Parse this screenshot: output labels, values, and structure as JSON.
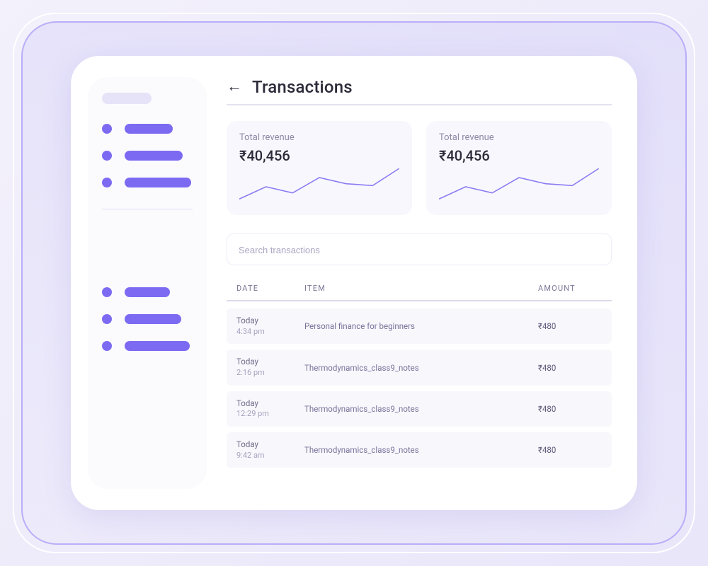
{
  "header": {
    "title": "Transactions",
    "back_icon": "arrow-left"
  },
  "cards": [
    {
      "label": "Total revenue",
      "value": "₹40,456"
    },
    {
      "label": "Total revenue",
      "value": "₹40,456"
    }
  ],
  "search": {
    "placeholder": "Search transactions"
  },
  "table": {
    "headers": {
      "date": "DATE",
      "item": "ITEM",
      "amount": "AMOUNT"
    },
    "rows": [
      {
        "date_line1": "Today",
        "date_line2": "4:34 pm",
        "item": "Personal finance for beginners",
        "amount": "₹480"
      },
      {
        "date_line1": "Today",
        "date_line2": "2:16 pm",
        "item": "Thermodynamics_class9_notes",
        "amount": "₹480"
      },
      {
        "date_line1": "Today",
        "date_line2": "12:29 pm",
        "item": "Thermodynamics_class9_notes",
        "amount": "₹480"
      },
      {
        "date_line1": "Today",
        "date_line2": "9:42 am",
        "item": "Thermodynamics_class9_notes",
        "amount": "₹480"
      }
    ]
  },
  "chart_data": [
    {
      "type": "line",
      "title": "Total revenue",
      "value_label": "₹40,456",
      "points": [
        10,
        30,
        20,
        45,
        35,
        32,
        60
      ],
      "ylim": [
        0,
        60
      ]
    },
    {
      "type": "line",
      "title": "Total revenue",
      "value_label": "₹40,456",
      "points": [
        10,
        30,
        20,
        45,
        35,
        32,
        60
      ],
      "ylim": [
        0,
        60
      ]
    }
  ],
  "colors": {
    "accent": "#7c6bf2",
    "muted_bg": "#f8f7fd"
  }
}
